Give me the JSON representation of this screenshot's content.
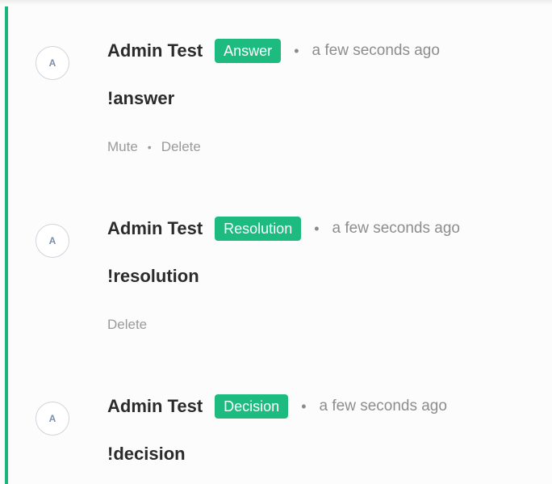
{
  "comments": [
    {
      "avatar_letter": "A",
      "author": "Admin Test",
      "tag": "Answer",
      "separator": "•",
      "time": "a few seconds ago",
      "body": "!answer",
      "actions": {
        "mute": "Mute",
        "separator": "•",
        "delete": "Delete"
      }
    },
    {
      "avatar_letter": "A",
      "author": "Admin Test",
      "tag": "Resolution",
      "separator": "•",
      "time": "a few seconds ago",
      "body": "!resolution",
      "actions": {
        "delete": "Delete"
      }
    },
    {
      "avatar_letter": "A",
      "author": "Admin Test",
      "tag": "Decision",
      "separator": "•",
      "time": "a few seconds ago",
      "body": "!decision"
    }
  ],
  "colors": {
    "accent": "#19b57a",
    "tag_background": "#1dbb80",
    "meta_text": "#8d8d8d"
  }
}
